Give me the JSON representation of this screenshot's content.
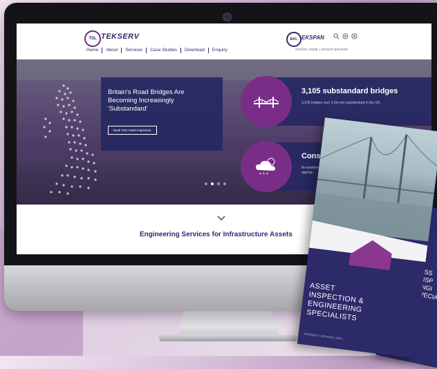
{
  "site": {
    "logo_text": "TEKSERV",
    "logo_badge": "TSL",
    "brand2_text": "EKSPAN",
    "brand2_badge": "EKL",
    "group_links": "GROUP HOME  |  GROUP BRANDS",
    "nav": [
      "Home",
      "About",
      "Services",
      "Case Studies",
      "Download",
      "Enquiry"
    ]
  },
  "hero": {
    "headline": "Britain's Road Bridges Are Becoming Increasingly 'Substandard'",
    "cta": "Book Your Asset Inspection",
    "stat1_title": "3,105 substandard bridges",
    "stat1_desc": "3,105 bridges over 1.5m are substandard in the UK.",
    "stat2_title": "Conside",
    "stat2_desc": "As weather ... volumes in... take approp..."
  },
  "tagline": "Engineering Services for Infrastructure Assets",
  "brochure": {
    "title_lines": [
      "ASSET",
      "INSPECTION &",
      "ENGINEERING",
      "SPECIALISTS"
    ],
    "small": "PROPERTY | ARCHIVE | SIGN...",
    "back_title_lines": [
      "ASS",
      "INSP",
      "ENGI",
      "SPECIA"
    ]
  },
  "colors": {
    "navy": "#2e2a6b",
    "purple": "#7a2d86",
    "panel": "#26286230"
  },
  "icons": [
    "search-icon",
    "bridge-icon",
    "cloud-weather-icon",
    "chevron-down-icon"
  ]
}
